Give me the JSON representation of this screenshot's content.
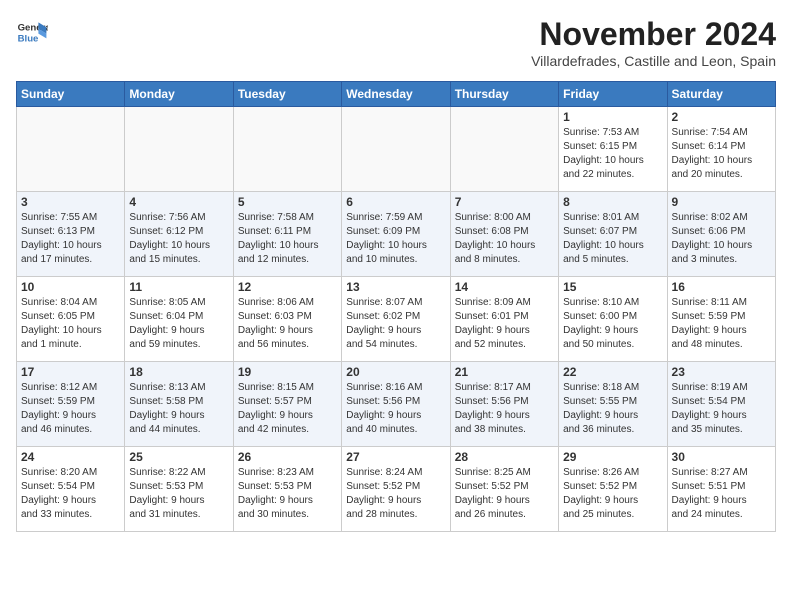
{
  "logo": {
    "line1": "General",
    "line2": "Blue"
  },
  "title": "November 2024",
  "subtitle": "Villardefrades, Castille and Leon, Spain",
  "headers": [
    "Sunday",
    "Monday",
    "Tuesday",
    "Wednesday",
    "Thursday",
    "Friday",
    "Saturday"
  ],
  "weeks": [
    [
      {
        "day": "",
        "info": ""
      },
      {
        "day": "",
        "info": ""
      },
      {
        "day": "",
        "info": ""
      },
      {
        "day": "",
        "info": ""
      },
      {
        "day": "",
        "info": ""
      },
      {
        "day": "1",
        "info": "Sunrise: 7:53 AM\nSunset: 6:15 PM\nDaylight: 10 hours\nand 22 minutes."
      },
      {
        "day": "2",
        "info": "Sunrise: 7:54 AM\nSunset: 6:14 PM\nDaylight: 10 hours\nand 20 minutes."
      }
    ],
    [
      {
        "day": "3",
        "info": "Sunrise: 7:55 AM\nSunset: 6:13 PM\nDaylight: 10 hours\nand 17 minutes."
      },
      {
        "day": "4",
        "info": "Sunrise: 7:56 AM\nSunset: 6:12 PM\nDaylight: 10 hours\nand 15 minutes."
      },
      {
        "day": "5",
        "info": "Sunrise: 7:58 AM\nSunset: 6:11 PM\nDaylight: 10 hours\nand 12 minutes."
      },
      {
        "day": "6",
        "info": "Sunrise: 7:59 AM\nSunset: 6:09 PM\nDaylight: 10 hours\nand 10 minutes."
      },
      {
        "day": "7",
        "info": "Sunrise: 8:00 AM\nSunset: 6:08 PM\nDaylight: 10 hours\nand 8 minutes."
      },
      {
        "day": "8",
        "info": "Sunrise: 8:01 AM\nSunset: 6:07 PM\nDaylight: 10 hours\nand 5 minutes."
      },
      {
        "day": "9",
        "info": "Sunrise: 8:02 AM\nSunset: 6:06 PM\nDaylight: 10 hours\nand 3 minutes."
      }
    ],
    [
      {
        "day": "10",
        "info": "Sunrise: 8:04 AM\nSunset: 6:05 PM\nDaylight: 10 hours\nand 1 minute."
      },
      {
        "day": "11",
        "info": "Sunrise: 8:05 AM\nSunset: 6:04 PM\nDaylight: 9 hours\nand 59 minutes."
      },
      {
        "day": "12",
        "info": "Sunrise: 8:06 AM\nSunset: 6:03 PM\nDaylight: 9 hours\nand 56 minutes."
      },
      {
        "day": "13",
        "info": "Sunrise: 8:07 AM\nSunset: 6:02 PM\nDaylight: 9 hours\nand 54 minutes."
      },
      {
        "day": "14",
        "info": "Sunrise: 8:09 AM\nSunset: 6:01 PM\nDaylight: 9 hours\nand 52 minutes."
      },
      {
        "day": "15",
        "info": "Sunrise: 8:10 AM\nSunset: 6:00 PM\nDaylight: 9 hours\nand 50 minutes."
      },
      {
        "day": "16",
        "info": "Sunrise: 8:11 AM\nSunset: 5:59 PM\nDaylight: 9 hours\nand 48 minutes."
      }
    ],
    [
      {
        "day": "17",
        "info": "Sunrise: 8:12 AM\nSunset: 5:59 PM\nDaylight: 9 hours\nand 46 minutes."
      },
      {
        "day": "18",
        "info": "Sunrise: 8:13 AM\nSunset: 5:58 PM\nDaylight: 9 hours\nand 44 minutes."
      },
      {
        "day": "19",
        "info": "Sunrise: 8:15 AM\nSunset: 5:57 PM\nDaylight: 9 hours\nand 42 minutes."
      },
      {
        "day": "20",
        "info": "Sunrise: 8:16 AM\nSunset: 5:56 PM\nDaylight: 9 hours\nand 40 minutes."
      },
      {
        "day": "21",
        "info": "Sunrise: 8:17 AM\nSunset: 5:56 PM\nDaylight: 9 hours\nand 38 minutes."
      },
      {
        "day": "22",
        "info": "Sunrise: 8:18 AM\nSunset: 5:55 PM\nDaylight: 9 hours\nand 36 minutes."
      },
      {
        "day": "23",
        "info": "Sunrise: 8:19 AM\nSunset: 5:54 PM\nDaylight: 9 hours\nand 35 minutes."
      }
    ],
    [
      {
        "day": "24",
        "info": "Sunrise: 8:20 AM\nSunset: 5:54 PM\nDaylight: 9 hours\nand 33 minutes."
      },
      {
        "day": "25",
        "info": "Sunrise: 8:22 AM\nSunset: 5:53 PM\nDaylight: 9 hours\nand 31 minutes."
      },
      {
        "day": "26",
        "info": "Sunrise: 8:23 AM\nSunset: 5:53 PM\nDaylight: 9 hours\nand 30 minutes."
      },
      {
        "day": "27",
        "info": "Sunrise: 8:24 AM\nSunset: 5:52 PM\nDaylight: 9 hours\nand 28 minutes."
      },
      {
        "day": "28",
        "info": "Sunrise: 8:25 AM\nSunset: 5:52 PM\nDaylight: 9 hours\nand 26 minutes."
      },
      {
        "day": "29",
        "info": "Sunrise: 8:26 AM\nSunset: 5:52 PM\nDaylight: 9 hours\nand 25 minutes."
      },
      {
        "day": "30",
        "info": "Sunrise: 8:27 AM\nSunset: 5:51 PM\nDaylight: 9 hours\nand 24 minutes."
      }
    ]
  ]
}
